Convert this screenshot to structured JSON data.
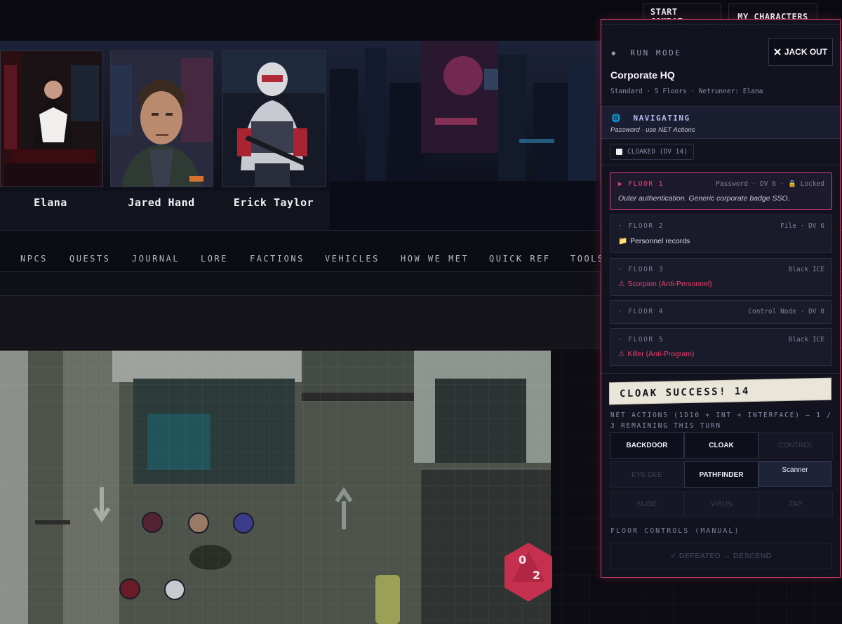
{
  "topbar": {
    "start_combat": "START COMBAT",
    "my_characters": "MY CHARACTERS"
  },
  "party": [
    {
      "name": "Elana"
    },
    {
      "name": "Jared Hand"
    },
    {
      "name": "Erick Taylor"
    }
  ],
  "nav": [
    "NPCS",
    "QUESTS",
    "JOURNAL",
    "LORE",
    "FACTIONS",
    "VEHICLES",
    "HOW WE MET",
    "QUICK REF",
    "TOOLS"
  ],
  "dice": {
    "left_face": "0",
    "right_face": "2"
  },
  "run": {
    "mode_label": "RUN MODE",
    "jack_out": "JACK OUT",
    "title": "Corporate HQ",
    "subtitle": "Standard · 5 Floors · Netrunner: Elana",
    "status_title": "NAVIGATING",
    "status_sub": "Password · use NET Actions",
    "cloak_label": "CLOAKED (DV 14)",
    "floors": [
      {
        "label": "▶ FLOOR 1",
        "meta": "Password · DV 6 ·",
        "lock": "Locked",
        "detail": "Outer authentication. Generic corporate badge SSO.",
        "detail_icon": "",
        "active": true,
        "color": "#c8c8d6"
      },
      {
        "label": "· FLOOR 2",
        "meta": "File · DV 6",
        "detail": "Personnel records",
        "detail_icon": "folder-icon",
        "color": "#d8d8e4"
      },
      {
        "label": "· FLOOR 3",
        "meta": "Black ICE",
        "detail": "Scorpion (Anti-Personnel)",
        "detail_icon": "warning-icon",
        "color": "#e9406a"
      },
      {
        "label": "· FLOOR 4",
        "meta": "Control Node · DV 8",
        "detail": "",
        "detail_icon": ""
      },
      {
        "label": "· FLOOR 5",
        "meta": "Black ICE",
        "detail": "Killer (Anti-Program)",
        "detail_icon": "warning-icon",
        "color": "#e9406a"
      }
    ],
    "banner": "CLOAK SUCCESS! 14",
    "net_actions": "NET ACTIONS (1D10 + INT + INTERFACE) — 1 / 3 REMAINING THIS TURN",
    "actions": [
      {
        "label": "BACKDOOR",
        "state": "on"
      },
      {
        "label": "CLOAK",
        "state": "on"
      },
      {
        "label": "CONTROL",
        "state": "off"
      },
      {
        "label": "EYE-DEE",
        "state": "off"
      },
      {
        "label": "PATHFINDER",
        "state": "on"
      },
      {
        "label": "Scanner",
        "state": "sel"
      },
      {
        "label": "SLIDE",
        "state": "off"
      },
      {
        "label": "VIRUS",
        "state": "off"
      },
      {
        "label": "ZAP",
        "state": "off"
      }
    ],
    "floor_controls_label": "FLOOR CONTROLS (MANUAL)",
    "descend": "✓ DEFEATED → DESCEND"
  },
  "colors": {
    "accent": "#d6427a",
    "panel": "#12131f",
    "danger": "#e9406a",
    "nav_status": "#b4b8ef"
  }
}
